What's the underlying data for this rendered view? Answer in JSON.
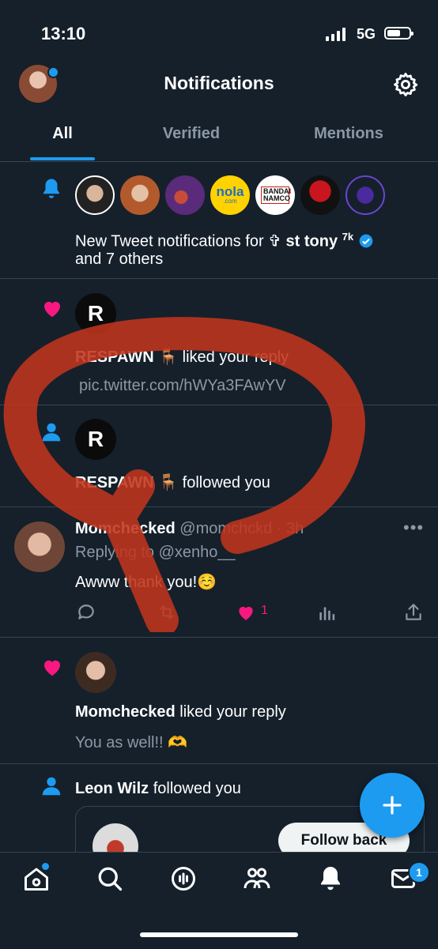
{
  "status_bar": {
    "time": "13:10",
    "network": "5G"
  },
  "header": {
    "title": "Notifications"
  },
  "tabs": [
    {
      "label": "All",
      "active": true
    },
    {
      "label": "Verified",
      "active": false
    },
    {
      "label": "Mentions",
      "active": false
    }
  ],
  "notifications": {
    "tweet_notice": {
      "prefix": "New Tweet notifications for ",
      "name": "✞ st tony",
      "superscript": "7k",
      "line2": "and 7 others",
      "avatar_labels": {
        "nola": "nola",
        "nola_sub": ".com",
        "bandai": "BANDAI NAMCO"
      }
    },
    "respawn_like": {
      "logo": "R",
      "name": "RESPAWN",
      "emoji": "🪑",
      "action": " liked your reply",
      "link": "pic.twitter.com/hWYa3FAwYV"
    },
    "respawn_follow": {
      "logo": "R",
      "name": "RESPAWN",
      "emoji": "🪑",
      "action": " followed you"
    },
    "reply_tweet": {
      "name": "Momchecked",
      "handle": "@momchckd",
      "time": "· 3h",
      "replying_to": "Replying to @xenho__",
      "text": "Awww thank you!☺️",
      "likes": "1"
    },
    "mom_like": {
      "name": "Momchecked",
      "action": " liked your reply",
      "text": "You as well!! 🫶"
    },
    "leon_follow": {
      "name": "Leon Wilz",
      "action": " followed you",
      "button": "Follow back"
    }
  },
  "bottom_nav": {
    "messages_badge": "1"
  },
  "colors": {
    "background": "#15202b",
    "accent": "#1d9bf0",
    "like": "#f91880",
    "annotation": "#c0341d"
  }
}
